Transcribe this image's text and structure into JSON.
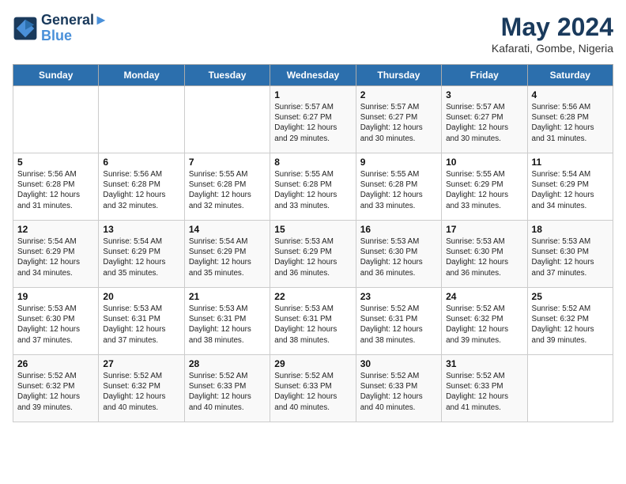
{
  "header": {
    "logo_line1": "General",
    "logo_line2": "Blue",
    "month_year": "May 2024",
    "location": "Kafarati, Gombe, Nigeria"
  },
  "weekdays": [
    "Sunday",
    "Monday",
    "Tuesday",
    "Wednesday",
    "Thursday",
    "Friday",
    "Saturday"
  ],
  "weeks": [
    [
      {
        "day": "",
        "info": ""
      },
      {
        "day": "",
        "info": ""
      },
      {
        "day": "",
        "info": ""
      },
      {
        "day": "1",
        "info": "Sunrise: 5:57 AM\nSunset: 6:27 PM\nDaylight: 12 hours\nand 29 minutes."
      },
      {
        "day": "2",
        "info": "Sunrise: 5:57 AM\nSunset: 6:27 PM\nDaylight: 12 hours\nand 30 minutes."
      },
      {
        "day": "3",
        "info": "Sunrise: 5:57 AM\nSunset: 6:27 PM\nDaylight: 12 hours\nand 30 minutes."
      },
      {
        "day": "4",
        "info": "Sunrise: 5:56 AM\nSunset: 6:28 PM\nDaylight: 12 hours\nand 31 minutes."
      }
    ],
    [
      {
        "day": "5",
        "info": "Sunrise: 5:56 AM\nSunset: 6:28 PM\nDaylight: 12 hours\nand 31 minutes."
      },
      {
        "day": "6",
        "info": "Sunrise: 5:56 AM\nSunset: 6:28 PM\nDaylight: 12 hours\nand 32 minutes."
      },
      {
        "day": "7",
        "info": "Sunrise: 5:55 AM\nSunset: 6:28 PM\nDaylight: 12 hours\nand 32 minutes."
      },
      {
        "day": "8",
        "info": "Sunrise: 5:55 AM\nSunset: 6:28 PM\nDaylight: 12 hours\nand 33 minutes."
      },
      {
        "day": "9",
        "info": "Sunrise: 5:55 AM\nSunset: 6:28 PM\nDaylight: 12 hours\nand 33 minutes."
      },
      {
        "day": "10",
        "info": "Sunrise: 5:55 AM\nSunset: 6:29 PM\nDaylight: 12 hours\nand 33 minutes."
      },
      {
        "day": "11",
        "info": "Sunrise: 5:54 AM\nSunset: 6:29 PM\nDaylight: 12 hours\nand 34 minutes."
      }
    ],
    [
      {
        "day": "12",
        "info": "Sunrise: 5:54 AM\nSunset: 6:29 PM\nDaylight: 12 hours\nand 34 minutes."
      },
      {
        "day": "13",
        "info": "Sunrise: 5:54 AM\nSunset: 6:29 PM\nDaylight: 12 hours\nand 35 minutes."
      },
      {
        "day": "14",
        "info": "Sunrise: 5:54 AM\nSunset: 6:29 PM\nDaylight: 12 hours\nand 35 minutes."
      },
      {
        "day": "15",
        "info": "Sunrise: 5:53 AM\nSunset: 6:29 PM\nDaylight: 12 hours\nand 36 minutes."
      },
      {
        "day": "16",
        "info": "Sunrise: 5:53 AM\nSunset: 6:30 PM\nDaylight: 12 hours\nand 36 minutes."
      },
      {
        "day": "17",
        "info": "Sunrise: 5:53 AM\nSunset: 6:30 PM\nDaylight: 12 hours\nand 36 minutes."
      },
      {
        "day": "18",
        "info": "Sunrise: 5:53 AM\nSunset: 6:30 PM\nDaylight: 12 hours\nand 37 minutes."
      }
    ],
    [
      {
        "day": "19",
        "info": "Sunrise: 5:53 AM\nSunset: 6:30 PM\nDaylight: 12 hours\nand 37 minutes."
      },
      {
        "day": "20",
        "info": "Sunrise: 5:53 AM\nSunset: 6:31 PM\nDaylight: 12 hours\nand 37 minutes."
      },
      {
        "day": "21",
        "info": "Sunrise: 5:53 AM\nSunset: 6:31 PM\nDaylight: 12 hours\nand 38 minutes."
      },
      {
        "day": "22",
        "info": "Sunrise: 5:53 AM\nSunset: 6:31 PM\nDaylight: 12 hours\nand 38 minutes."
      },
      {
        "day": "23",
        "info": "Sunrise: 5:52 AM\nSunset: 6:31 PM\nDaylight: 12 hours\nand 38 minutes."
      },
      {
        "day": "24",
        "info": "Sunrise: 5:52 AM\nSunset: 6:32 PM\nDaylight: 12 hours\nand 39 minutes."
      },
      {
        "day": "25",
        "info": "Sunrise: 5:52 AM\nSunset: 6:32 PM\nDaylight: 12 hours\nand 39 minutes."
      }
    ],
    [
      {
        "day": "26",
        "info": "Sunrise: 5:52 AM\nSunset: 6:32 PM\nDaylight: 12 hours\nand 39 minutes."
      },
      {
        "day": "27",
        "info": "Sunrise: 5:52 AM\nSunset: 6:32 PM\nDaylight: 12 hours\nand 40 minutes."
      },
      {
        "day": "28",
        "info": "Sunrise: 5:52 AM\nSunset: 6:33 PM\nDaylight: 12 hours\nand 40 minutes."
      },
      {
        "day": "29",
        "info": "Sunrise: 5:52 AM\nSunset: 6:33 PM\nDaylight: 12 hours\nand 40 minutes."
      },
      {
        "day": "30",
        "info": "Sunrise: 5:52 AM\nSunset: 6:33 PM\nDaylight: 12 hours\nand 40 minutes."
      },
      {
        "day": "31",
        "info": "Sunrise: 5:52 AM\nSunset: 6:33 PM\nDaylight: 12 hours\nand 41 minutes."
      },
      {
        "day": "",
        "info": ""
      }
    ]
  ]
}
